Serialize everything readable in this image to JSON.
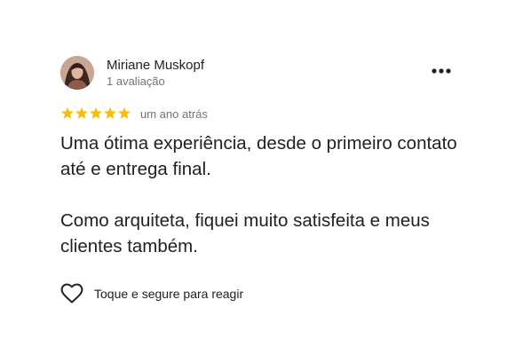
{
  "review": {
    "reviewer_name": "Miriane Muskopf",
    "review_count": "1 avaliação",
    "rating": 5,
    "rating_max": 5,
    "time_ago": "um ano atrás",
    "paragraphs": [
      "Uma ótima experiência, desde o primeiro contato até e entrega final.",
      "Como arquiteta, fiquei muito satisfeita e meus clientes também."
    ],
    "react_label": "Toque e segure para reagir"
  },
  "icons": {
    "avatar": "avatar-photo",
    "more": "more-horizontal-icon",
    "star": "star-icon",
    "react": "heart-outline-icon"
  },
  "colors": {
    "star": "#fbbc04",
    "text_primary": "#202124",
    "text_secondary": "#70757a"
  }
}
